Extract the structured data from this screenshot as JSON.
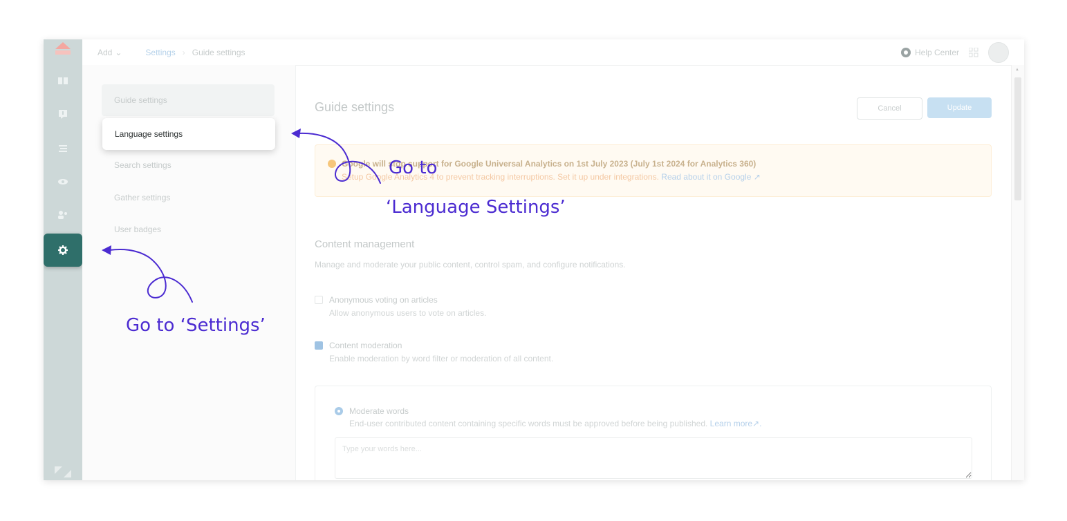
{
  "topbar": {
    "add_label": "Add",
    "breadcrumb_link": "Settings",
    "breadcrumb_current": "Guide settings",
    "help_label": "Help Center"
  },
  "subnav": {
    "items": [
      {
        "label": "Guide settings"
      },
      {
        "label": "Language settings"
      },
      {
        "label": "Search settings"
      },
      {
        "label": "Gather settings"
      },
      {
        "label": "User badges"
      }
    ]
  },
  "main": {
    "title": "Guide settings",
    "cancel_label": "Cancel",
    "update_label": "Update",
    "alert": {
      "line1": "Google will stop support for Google Universal Analytics on 1st July 2023 (July 1st 2024 for Analytics 360)",
      "line2": "Setup Google Analytics 4 to prevent tracking interruptions. Set it up under integrations.",
      "link": "Read about it on Google"
    },
    "section_title": "Content management",
    "section_desc": "Manage and moderate your public content, control spam, and configure notifications.",
    "anon_label": "Anonymous voting on articles",
    "anon_desc": "Allow anonymous users to vote on articles.",
    "moderation_label": "Content moderation",
    "moderation_desc": "Enable moderation by word filter or moderation of all content.",
    "moderate_words_label": "Moderate words",
    "moderate_words_desc": "End-user contributed content containing specific words must be approved before being published.",
    "learn_more": "Learn more",
    "words_placeholder": "Type your words here..."
  },
  "annotations": {
    "lang_line1": "Go to",
    "lang_line2": "‘Language Settings’",
    "settings": "Go to ‘Settings’",
    "color": "#4b2bd1"
  }
}
